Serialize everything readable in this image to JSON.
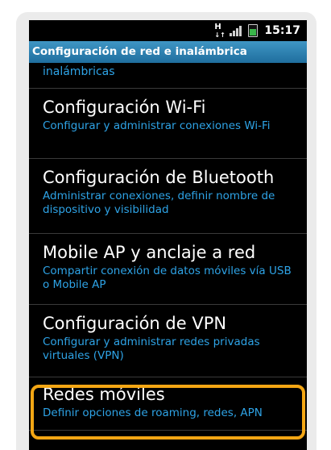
{
  "status": {
    "network_type": "H",
    "time": "15:17",
    "icons": [
      "hspa-data-icon",
      "signal-strength-icon",
      "battery-icon"
    ]
  },
  "title": "Configuración de red e inalámbrica",
  "partial_item": "inalámbricas",
  "items": [
    {
      "title": "Configuración Wi-Fi",
      "subtitle": "Configurar y administrar conexiones Wi-Fi"
    },
    {
      "title": "Configuración de Bluetooth",
      "subtitle": "Administrar conexiones, definir nombre de dispositivo y visibilidad"
    },
    {
      "title": "Mobile AP y anclaje a red",
      "subtitle": "Compartir conexión de datos móviles vía USB o Mobile AP"
    },
    {
      "title": "Configuración de VPN",
      "subtitle": "Configurar y administrar redes privadas virtuales (VPN)"
    },
    {
      "title": "Redes móviles",
      "subtitle": "Definir opciones de roaming, redes, APN"
    }
  ],
  "colors": {
    "accent": "#2ea3e6",
    "titlebar": "#2a82b5",
    "highlight": "#f3a614"
  }
}
